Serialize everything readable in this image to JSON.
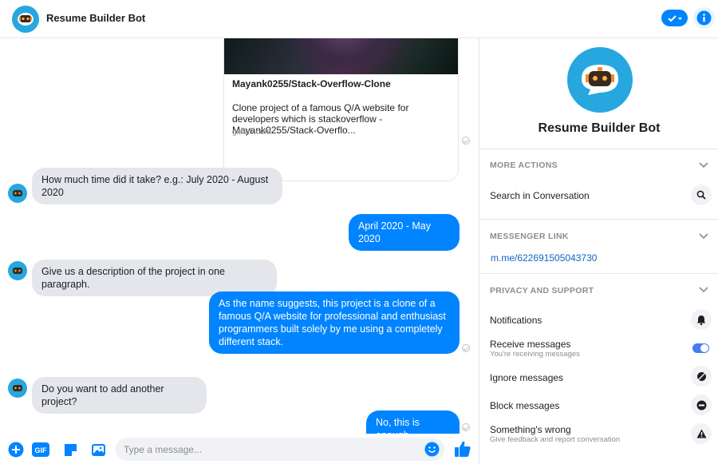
{
  "header": {
    "title": "Resume Builder Bot",
    "check_icon": "checkmark-icon",
    "info_icon": "info-icon"
  },
  "chat": {
    "link_card": {
      "title": "Mayank0255/Stack-Overflow-Clone",
      "description": "Clone project of a famous Q/A website for developers which is stackoverflow - Mayank0255/Stack-Overflo...",
      "domain": "github.com"
    },
    "messages": [
      {
        "from": "bot",
        "text": "How much time did it take? e.g.: July 2020 - August 2020"
      },
      {
        "from": "user",
        "text": "April 2020 - May 2020"
      },
      {
        "from": "bot",
        "text": "Give us a description of the project in one paragraph."
      },
      {
        "from": "user",
        "text": "As the name suggests, this project is a clone of a famous Q/A website for professional and enthusiast programmers built solely by me using a completely different stack."
      },
      {
        "from": "bot",
        "text": "Do you want to add another project?"
      },
      {
        "from": "user",
        "text": "No, this is enough"
      }
    ]
  },
  "composer": {
    "placeholder": "Type a message...",
    "icons": [
      "plus-icon",
      "gif-icon",
      "sticker-icon",
      "image-icon",
      "emoji-icon",
      "thumbs-up-icon"
    ],
    "gif_label": "GIF"
  },
  "sidebar": {
    "name": "Resume Builder Bot",
    "more_actions": {
      "title": "MORE ACTIONS",
      "search_label": "Search in Conversation"
    },
    "messenger_link": {
      "title": "MESSENGER LINK",
      "url": "m.me/622691505043730"
    },
    "privacy": {
      "title": "PRIVACY AND SUPPORT",
      "notifications": "Notifications",
      "receive": "Receive messages",
      "receive_sub": "You're receiving messages",
      "receive_enabled": true,
      "ignore": "Ignore messages",
      "block": "Block messages",
      "wrong": "Something's wrong",
      "wrong_sub": "Give feedback and report conversation"
    }
  },
  "colors": {
    "accent": "#0084ff",
    "bubble_in": "#e4e6eb",
    "link": "#0a66c2"
  }
}
